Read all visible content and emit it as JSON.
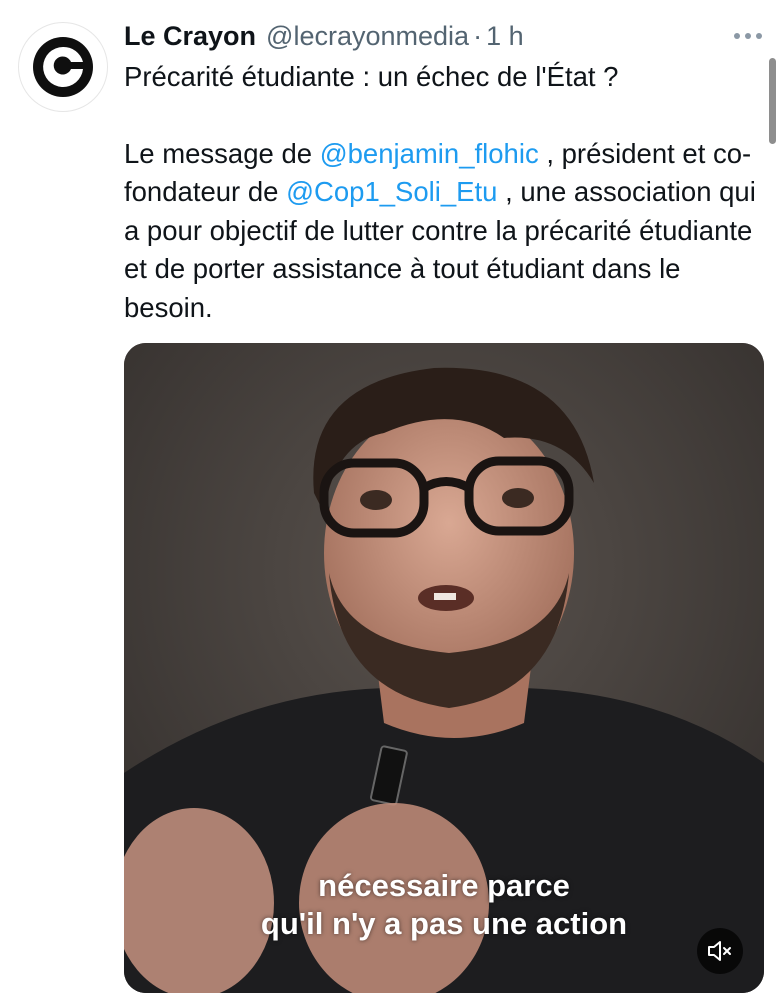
{
  "author": {
    "display_name": "Le Crayon",
    "handle": "@lecrayonmedia",
    "separator": "·",
    "time": "1 h"
  },
  "tweet": {
    "line1": "Précarité étudiante : un échec de l'État ?",
    "part1": "Le message de ",
    "mention1": "@benjamin_flohic",
    "part2": " , président et co-fondateur de ",
    "mention2": "@Cop1_Soli_Etu",
    "part3": " , une association qui a pour objectif de lutter contre la précarité étudiante et de porter assistance à tout étudiant dans le besoin."
  },
  "video": {
    "caption_line1": "nécessaire parce",
    "caption_line2": "qu'il n'y a pas une action",
    "mute_icon": "speaker-muted-icon"
  },
  "icons": {
    "avatar": "le-crayon-logo",
    "more": "more-dots-icon"
  },
  "colors": {
    "mention": "#1d9bf0",
    "text": "#0f1419",
    "secondary": "#536471"
  }
}
